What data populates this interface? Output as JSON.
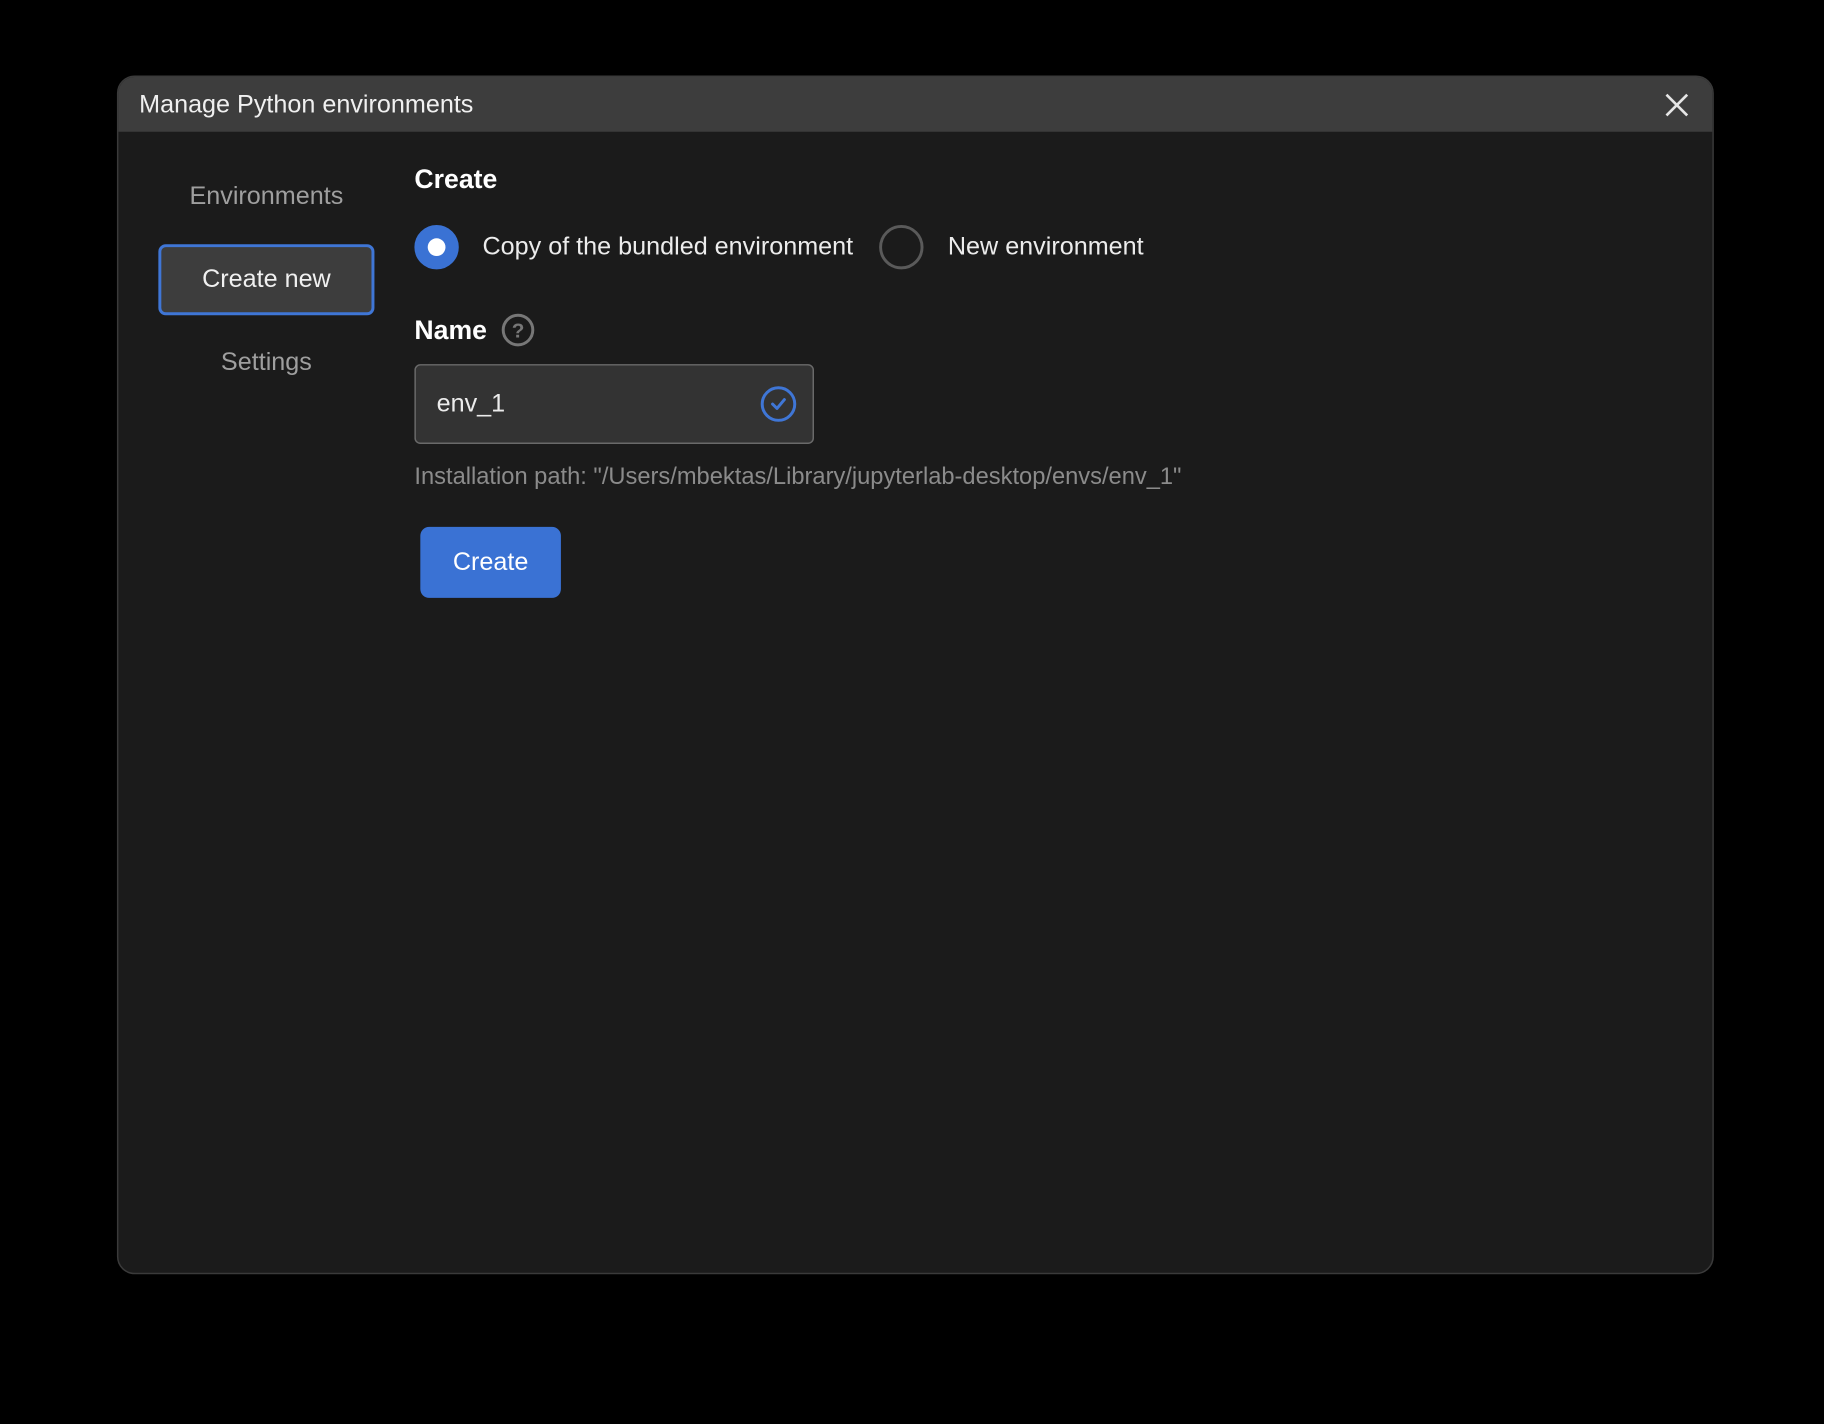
{
  "dialog": {
    "title": "Manage Python environments"
  },
  "sidebar": {
    "items": [
      {
        "label": "Environments",
        "active": false
      },
      {
        "label": "Create new",
        "active": true
      },
      {
        "label": "Settings",
        "active": false
      }
    ]
  },
  "main": {
    "create_section_title": "Create",
    "radio": {
      "copy_label": "Copy of the bundled environment",
      "new_label": "New environment",
      "selected": "copy"
    },
    "name_field": {
      "label": "Name",
      "value": "env_1"
    },
    "install_path": "Installation path: \"/Users/mbektas/Library/jupyterlab-desktop/envs/env_1\"",
    "create_button": "Create"
  }
}
